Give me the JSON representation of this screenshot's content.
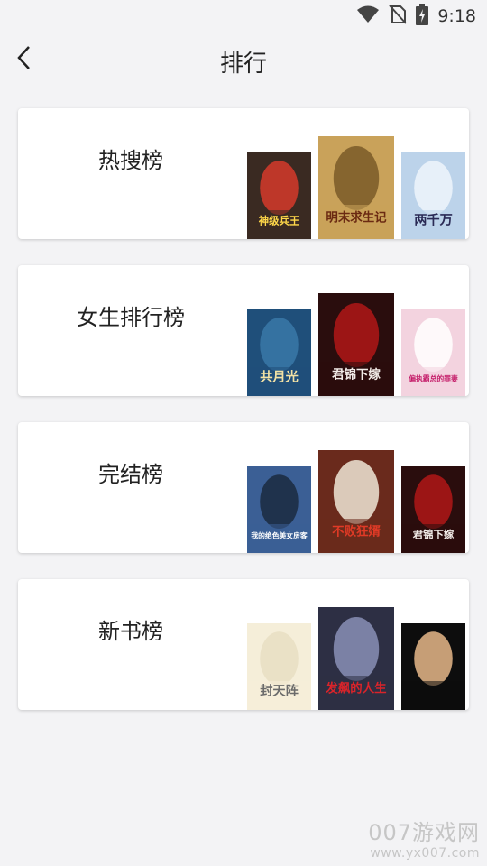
{
  "status_bar": {
    "time": "9:18",
    "icons": [
      "wifi-icon",
      "no-sim-icon",
      "battery-charging-icon"
    ]
  },
  "header": {
    "title": "排行",
    "back_icon": "chevron-left-icon"
  },
  "rankings": [
    {
      "title": "热搜榜",
      "covers": [
        {
          "text": "神级兵王",
          "sub": "",
          "bg": "#3a2a22",
          "accent": "#d63a2a",
          "fg": "#ffd84a"
        },
        {
          "text": "明末求生记",
          "sub": "",
          "bg": "#c9a25a",
          "accent": "#7a5a28",
          "fg": "#6b2a12"
        },
        {
          "text": "两千万",
          "sub": "",
          "bg": "#bcd3ea",
          "accent": "#eef4fb",
          "fg": "#2a2a55"
        }
      ]
    },
    {
      "title": "女生排行榜",
      "covers": [
        {
          "text": "共月光",
          "sub": "",
          "bg": "#1f4f7a",
          "accent": "#3a78a8",
          "fg": "#f3e2a5"
        },
        {
          "text": "君锦下嫁",
          "sub": "",
          "bg": "#2a0d0d",
          "accent": "#b01818",
          "fg": "#f2ece8"
        },
        {
          "text": "偏执霸总的罪妻",
          "sub": "",
          "bg": "#f3d3df",
          "accent": "#ffffff",
          "fg": "#c51e6a"
        }
      ]
    },
    {
      "title": "完结榜",
      "covers": [
        {
          "text": "我的绝色美女房客",
          "sub": "",
          "bg": "#3b5f95",
          "accent": "#1b2a3f",
          "fg": "#ffffff"
        },
        {
          "text": "不败狂婿",
          "sub": "",
          "bg": "#6a2a1c",
          "accent": "#efe6d6",
          "fg": "#e03a26"
        },
        {
          "text": "君锦下嫁",
          "sub": "",
          "bg": "#2a0d0d",
          "accent": "#b01818",
          "fg": "#f2ece8"
        }
      ]
    },
    {
      "title": "新书榜",
      "covers": [
        {
          "text": "封天阵",
          "sub": "",
          "bg": "#f5eed9",
          "accent": "#e8dec2",
          "fg": "#6b6b6b"
        },
        {
          "text": "发飙的人生",
          "sub": "",
          "bg": "#2d2f44",
          "accent": "#8a8fb6",
          "fg": "#d9242a"
        },
        {
          "text": "",
          "sub": "",
          "bg": "#0d0d0d",
          "accent": "#e8b98a",
          "fg": "#ffffff"
        }
      ]
    }
  ],
  "watermark": {
    "logo": "007游戏网",
    "url": "www.yx007.com"
  }
}
